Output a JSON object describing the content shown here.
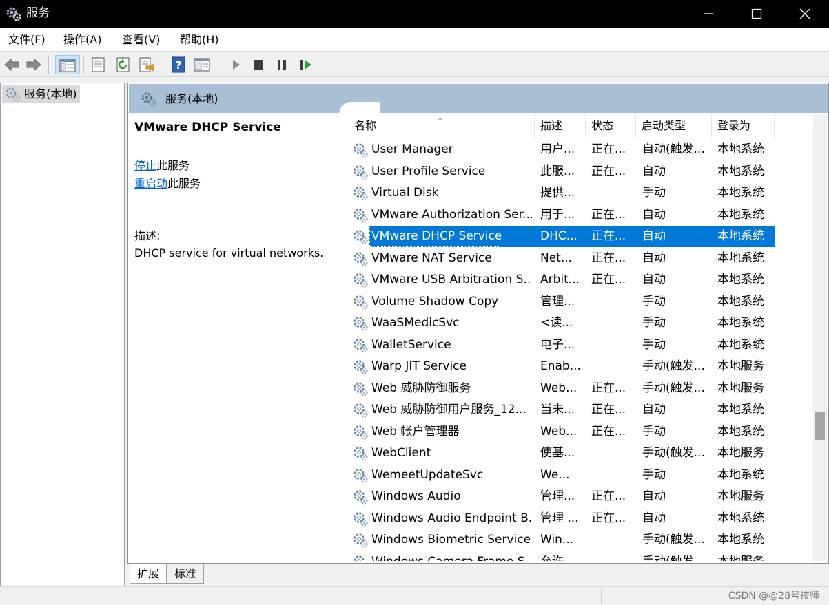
{
  "window": {
    "title": "服务",
    "icon": "gears-icon"
  },
  "menu": [
    "文件(F)",
    "操作(A)",
    "查看(V)",
    "帮助(H)"
  ],
  "toolbar": {
    "buttons": [
      "back-arrow-icon",
      "forward-arrow-icon",
      "console-tree-icon",
      "properties-icon",
      "refresh-icon",
      "export-list-icon",
      "help-icon",
      "view-icon",
      "play-icon",
      "stop-icon",
      "pause-icon",
      "restart-icon"
    ]
  },
  "tree": {
    "item": "服务(本地)"
  },
  "panel": {
    "header": "服务(本地)",
    "selected_service": "VMware DHCP Service",
    "actions": [
      {
        "link": "停止",
        "suffix": "此服务"
      },
      {
        "link": "重启动",
        "suffix": "此服务"
      }
    ],
    "desc_label": "描述:",
    "desc_text": "DHCP service for virtual networks."
  },
  "list": {
    "sort_indicator": "^",
    "columns": [
      "名称",
      "描述",
      "状态",
      "启动类型",
      "登录为"
    ],
    "rows": [
      {
        "name": "User Manager",
        "desc": "用户...",
        "status": "正在...",
        "startup": "自动(触发...",
        "logon": "本地系统"
      },
      {
        "name": "User Profile Service",
        "desc": "此服...",
        "status": "正在...",
        "startup": "自动",
        "logon": "本地系统"
      },
      {
        "name": "Virtual Disk",
        "desc": "提供...",
        "status": "",
        "startup": "手动",
        "logon": "本地系统"
      },
      {
        "name": "VMware Authorization Ser...",
        "desc": "用于...",
        "status": "正在...",
        "startup": "自动",
        "logon": "本地系统"
      },
      {
        "name": "VMware DHCP Service",
        "desc": "DHC...",
        "status": "正在...",
        "startup": "自动",
        "logon": "本地系统",
        "selected": true
      },
      {
        "name": "VMware NAT Service",
        "desc": "Net...",
        "status": "正在...",
        "startup": "自动",
        "logon": "本地系统"
      },
      {
        "name": "VMware USB Arbitration S...",
        "desc": "Arbit...",
        "status": "正在...",
        "startup": "自动",
        "logon": "本地系统"
      },
      {
        "name": "Volume Shadow Copy",
        "desc": "管理...",
        "status": "",
        "startup": "手动",
        "logon": "本地系统"
      },
      {
        "name": "WaaSMedicSvc",
        "desc": "<读...",
        "status": "",
        "startup": "手动",
        "logon": "本地系统"
      },
      {
        "name": "WalletService",
        "desc": "电子...",
        "status": "",
        "startup": "手动",
        "logon": "本地系统"
      },
      {
        "name": "Warp JIT Service",
        "desc": "Enab...",
        "status": "",
        "startup": "手动(触发...",
        "logon": "本地服务"
      },
      {
        "name": "Web 威胁防御服务",
        "desc": "Web...",
        "status": "正在...",
        "startup": "手动(触发...",
        "logon": "本地服务"
      },
      {
        "name": "Web 威胁防御用户服务_12...",
        "desc": "当未...",
        "status": "正在...",
        "startup": "自动",
        "logon": "本地系统"
      },
      {
        "name": "Web 帐户管理器",
        "desc": "Web...",
        "status": "正在...",
        "startup": "手动",
        "logon": "本地系统"
      },
      {
        "name": "WebClient",
        "desc": "使基...",
        "status": "",
        "startup": "手动(触发...",
        "logon": "本地服务"
      },
      {
        "name": "WemeetUpdateSvc",
        "desc": "We...",
        "status": "",
        "startup": "手动",
        "logon": "本地系统"
      },
      {
        "name": "Windows Audio",
        "desc": "管理...",
        "status": "正在...",
        "startup": "自动",
        "logon": "本地服务"
      },
      {
        "name": "Windows Audio Endpoint B...",
        "desc": "管理 ...",
        "status": "正在...",
        "startup": "自动",
        "logon": "本地系统"
      },
      {
        "name": "Windows Biometric Service",
        "desc": "Win...",
        "status": "",
        "startup": "手动(触发...",
        "logon": "本地系统"
      },
      {
        "name": "Windows Camera Frame S...",
        "desc": "允许...",
        "status": "",
        "startup": "手动(触发...",
        "logon": "本地服务"
      }
    ]
  },
  "tabs": [
    "扩展",
    "标准"
  ],
  "watermark": "CSDN @@28号技师"
}
